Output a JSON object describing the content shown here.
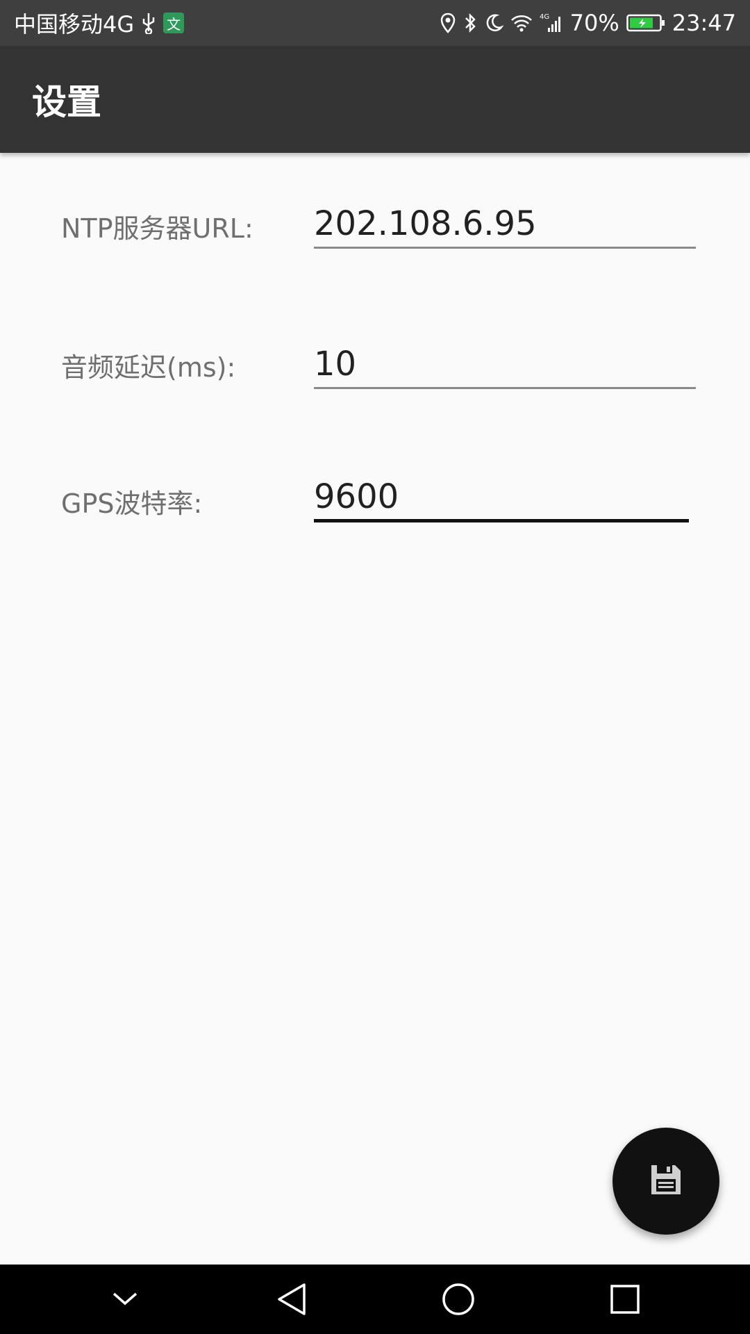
{
  "status_bar": {
    "carrier": "中国移动4G",
    "app_badge": "文",
    "battery": "70%",
    "time": "23:47",
    "icons": [
      "usb-icon",
      "location-icon",
      "bluetooth-icon",
      "moon-icon",
      "wifi-icon",
      "signal-icon",
      "battery-icon"
    ]
  },
  "toolbar": {
    "title": "设置"
  },
  "settings": {
    "ntp_label": "NTP服务器URL:",
    "ntp_value": "202.108.6.95",
    "audio_delay_label": "音频延迟(ms):",
    "audio_delay_value": "10",
    "gps_baud_label": "GPS波特率:",
    "gps_baud_value": "9600"
  },
  "fab": {
    "icon": "save-icon"
  },
  "nav_bar": {
    "icons": [
      "chevron-down-icon",
      "back-icon",
      "home-icon",
      "recents-icon"
    ]
  },
  "colors": {
    "toolbar": "#333333",
    "status_bar": "#3f3f3f",
    "background": "#fafafa",
    "fab": "#111111"
  }
}
